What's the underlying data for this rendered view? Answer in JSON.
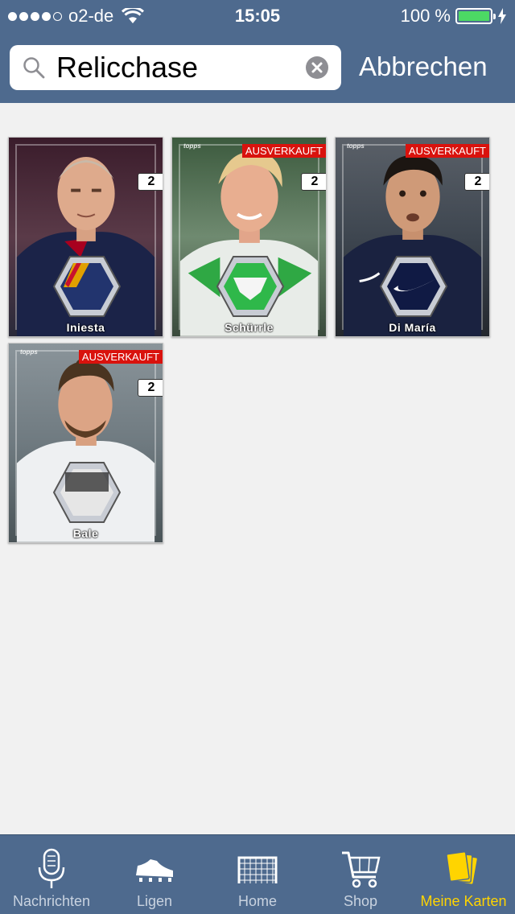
{
  "status_bar": {
    "carrier": "o2-de",
    "time": "15:05",
    "battery": "100 %"
  },
  "search": {
    "value": "Relicchase",
    "cancel_label": "Abbrechen"
  },
  "cards": [
    {
      "name": "Iniesta",
      "count": "2",
      "sold_out": ""
    },
    {
      "name": "Schürrle",
      "count": "2",
      "sold_out": "AUSVERKAUFT"
    },
    {
      "name": "Di María",
      "count": "2",
      "sold_out": "AUSVERKAUFT"
    },
    {
      "name": "Bale",
      "count": "2",
      "sold_out": "AUSVERKAUFT"
    }
  ],
  "tabbar": {
    "items": [
      {
        "label": "Nachrichten",
        "icon": "microphone-icon"
      },
      {
        "label": "Ligen",
        "icon": "football-boot-icon"
      },
      {
        "label": "Home",
        "icon": "goal-icon"
      },
      {
        "label": "Shop",
        "icon": "shopping-cart-icon"
      },
      {
        "label": "Meine Karten",
        "icon": "cards-icon",
        "active": true
      }
    ]
  },
  "colors": {
    "header": "#4e6a8e",
    "active_tab": "#ffd400",
    "sold_out": "#d9120d",
    "battery": "#4cd964"
  }
}
